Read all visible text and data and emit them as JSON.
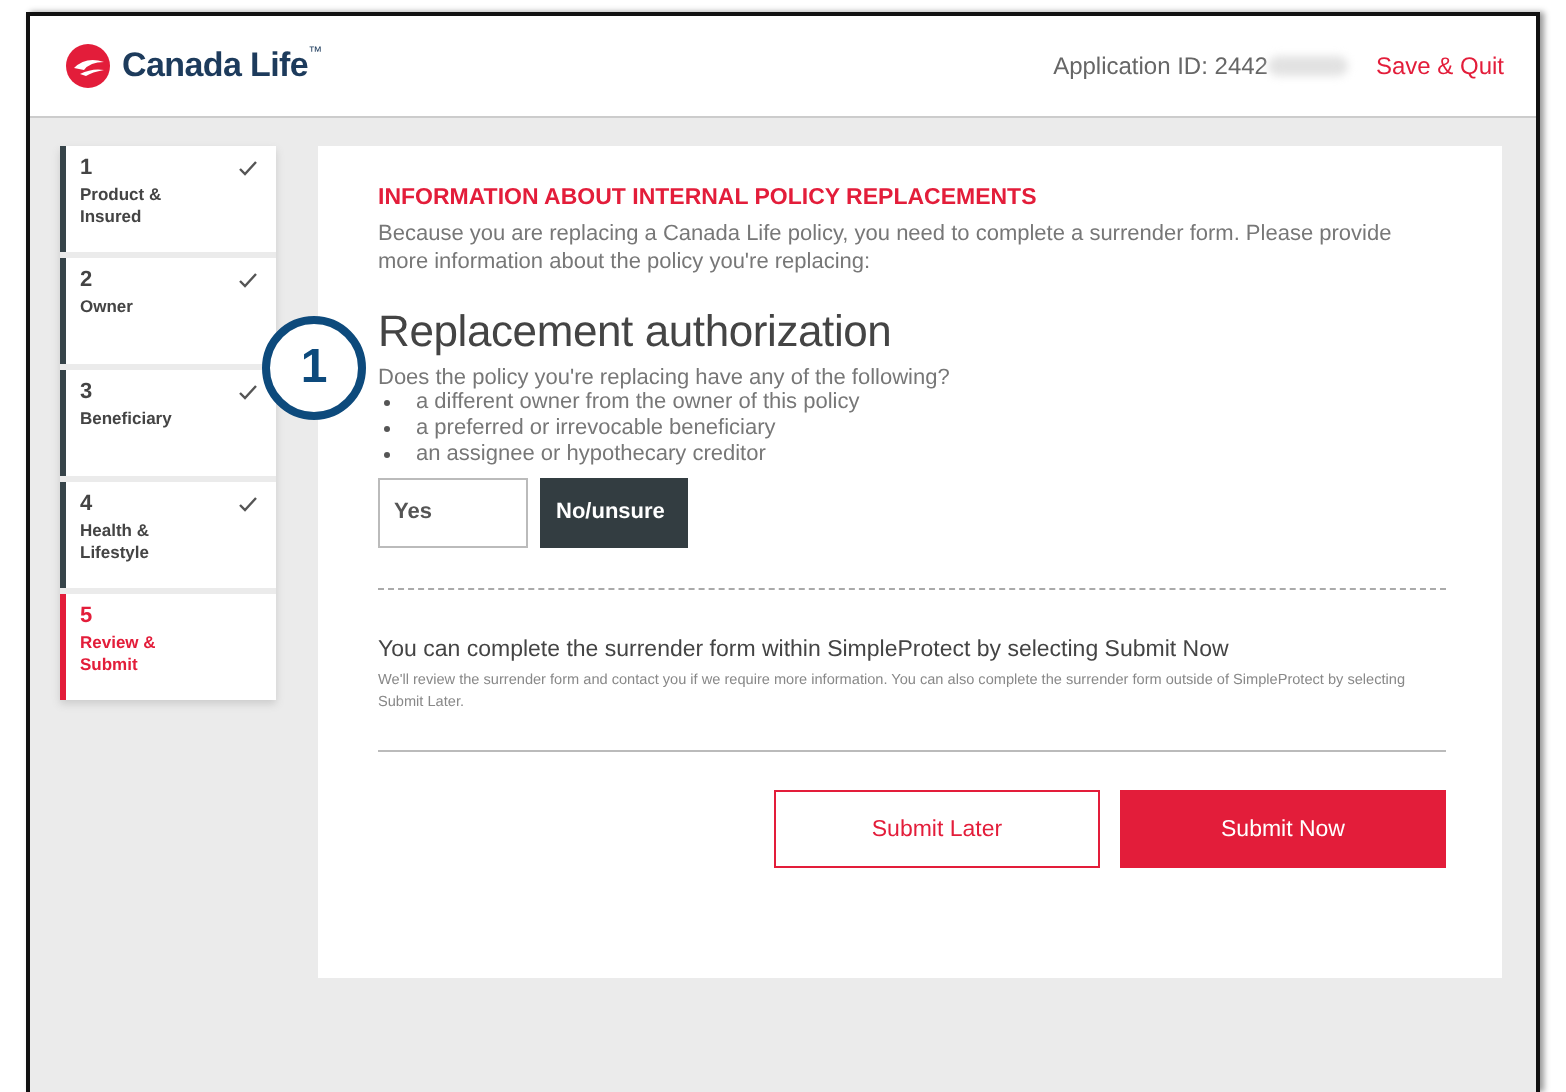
{
  "header": {
    "brand": "Canada Life",
    "trademark": "™",
    "application_id": "Application ID: 2442",
    "save_quit": "Save & Quit"
  },
  "steps": [
    {
      "number": "1",
      "label": "Product & Insured",
      "completed": true,
      "selected": false
    },
    {
      "number": "2",
      "label": "Owner",
      "completed": true,
      "selected": false
    },
    {
      "number": "3",
      "label": "Beneficiary",
      "completed": true,
      "selected": false
    },
    {
      "number": "4",
      "label": "Health & Lifestyle",
      "completed": true,
      "selected": false
    },
    {
      "number": "5",
      "label": "Review & Submit",
      "completed": false,
      "selected": true
    }
  ],
  "section": {
    "title": "INFORMATION ABOUT INTERNAL POLICY REPLACEMENTS",
    "intro": "Because you are replacing a Canada Life policy, you need to complete a surrender form. Please provide more information about the policy you're replacing:"
  },
  "callout": "1",
  "question": {
    "heading": "Replacement authorization",
    "prompt": "Does the policy you're replacing have any of the following?",
    "bullets": [
      "a different owner from the owner of this policy",
      "a preferred or irrevocable beneficiary",
      "an assignee or hypothecary creditor"
    ],
    "options": [
      {
        "label": "Yes",
        "selected": false
      },
      {
        "label": "No/unsure",
        "selected": true
      }
    ]
  },
  "submit_info": {
    "heading": "You can complete the surrender form within SimpleProtect by selecting Submit Now",
    "detail": "We'll review the surrender form and contact you if we require more information. You can also complete the surrender form outside of SimpleProtect by selecting Submit Later."
  },
  "buttons": [
    {
      "label": "Submit Later",
      "kind": "secondary"
    },
    {
      "label": "Submit Now",
      "kind": "primary"
    }
  ]
}
